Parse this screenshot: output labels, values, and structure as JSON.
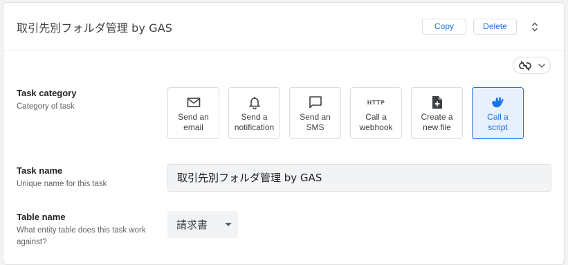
{
  "header": {
    "title": "取引先別フォルダ管理 by GAS",
    "copy_label": "Copy",
    "delete_label": "Delete"
  },
  "task_category": {
    "label": "Task category",
    "description": "Category of task",
    "options": [
      {
        "label": "Send an\nemail",
        "icon": "mail-icon"
      },
      {
        "label": "Send a\nnotification",
        "icon": "bell-icon"
      },
      {
        "label": "Send an\nSMS",
        "icon": "sms-icon"
      },
      {
        "label": "Call a\nwebhook",
        "icon": "http-icon",
        "icon_text": "HTTP"
      },
      {
        "label": "Create a\nnew file",
        "icon": "file-add-icon"
      },
      {
        "label": "Call a\nscript",
        "icon": "script-icon",
        "selected": true
      }
    ]
  },
  "task_name": {
    "label": "Task name",
    "description": "Unique name for this task",
    "value": "取引先別フォルダ管理 by GAS"
  },
  "table_name": {
    "label": "Table name",
    "description": "What entity table does this task work against?",
    "value": "請求書"
  },
  "colors": {
    "accent": "#1a73e8",
    "selected_bg": "#e8f0fe"
  }
}
